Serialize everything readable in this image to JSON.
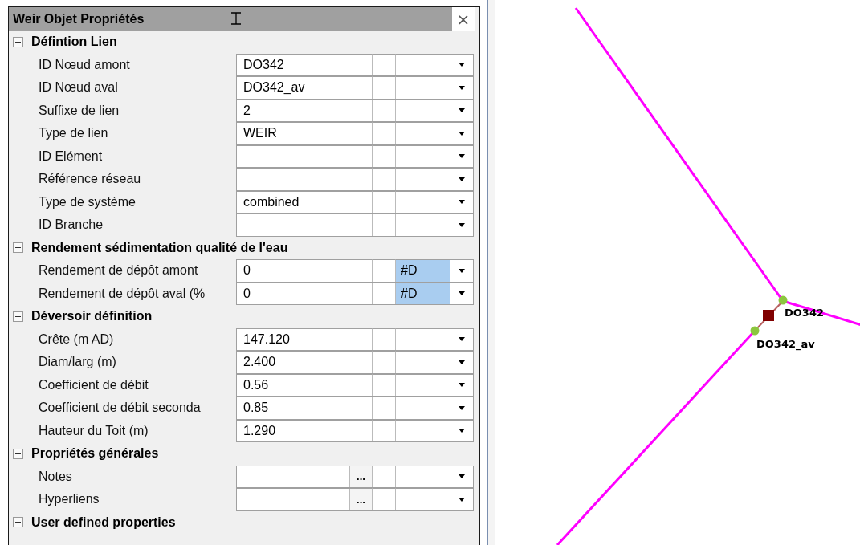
{
  "panel": {
    "title": "Weir Objet Propriétés",
    "close": "×"
  },
  "groups": [
    {
      "label": "Défintion Lien",
      "expanded": true,
      "rows": [
        {
          "label": "ID Nœud amont",
          "value": "DO342",
          "kind": "combo",
          "highlighted": false
        },
        {
          "label": "ID Nœud aval",
          "value": "DO342_av",
          "kind": "combo",
          "highlighted": false
        },
        {
          "label": "Suffixe de lien",
          "value": "2",
          "kind": "combo",
          "highlighted": false
        },
        {
          "label": "Type de lien",
          "value": "WEIR",
          "kind": "combo",
          "highlighted": false
        },
        {
          "label": "ID Elément",
          "kind": "combo",
          "highlighted": false
        },
        {
          "label": "Référence réseau",
          "kind": "combo",
          "highlighted": false
        },
        {
          "label": "Type de système",
          "value": "combined",
          "kind": "combo",
          "highlighted": false
        },
        {
          "label": "ID Branche",
          "kind": "combo",
          "highlighted": false
        }
      ]
    },
    {
      "label": "Rendement sédimentation qualité de l'eau",
      "expanded": true,
      "rows": [
        {
          "label": "Rendement de dépôt amont",
          "value": "0",
          "kind": "combo",
          "unit": "#D",
          "highlighted": true
        },
        {
          "label": "Rendement de dépôt aval (%",
          "value": "0",
          "kind": "combo",
          "unit": "#D",
          "highlighted": true
        }
      ]
    },
    {
      "label": "Déversoir définition",
      "expanded": true,
      "rows": [
        {
          "label": "Crête (m AD)",
          "value": "147.120",
          "kind": "combo",
          "highlighted": false
        },
        {
          "label": "Diam/larg (m)",
          "value": "2.400",
          "kind": "combo",
          "highlighted": false
        },
        {
          "label": "Coefficient de débit",
          "value": "0.56",
          "kind": "combo",
          "highlighted": false
        },
        {
          "label": "Coefficient de débit seconda",
          "value": "0.85",
          "kind": "combo",
          "highlighted": false
        },
        {
          "label": "Hauteur du Toit (m)",
          "value": "1.290",
          "kind": "combo",
          "highlighted": false
        }
      ]
    },
    {
      "label": "Propriétés générales",
      "expanded": true,
      "rows": [
        {
          "label": "Notes",
          "kind": "ellipsis",
          "button": "...",
          "highlighted": false
        },
        {
          "label": "Hyperliens",
          "kind": "ellipsis",
          "button": "...",
          "highlighted": false
        }
      ]
    },
    {
      "label": "User defined properties",
      "expanded": false
    }
  ],
  "map": {
    "nodes": [
      {
        "label": "DO342"
      },
      {
        "label": "DO342_av"
      }
    ]
  }
}
